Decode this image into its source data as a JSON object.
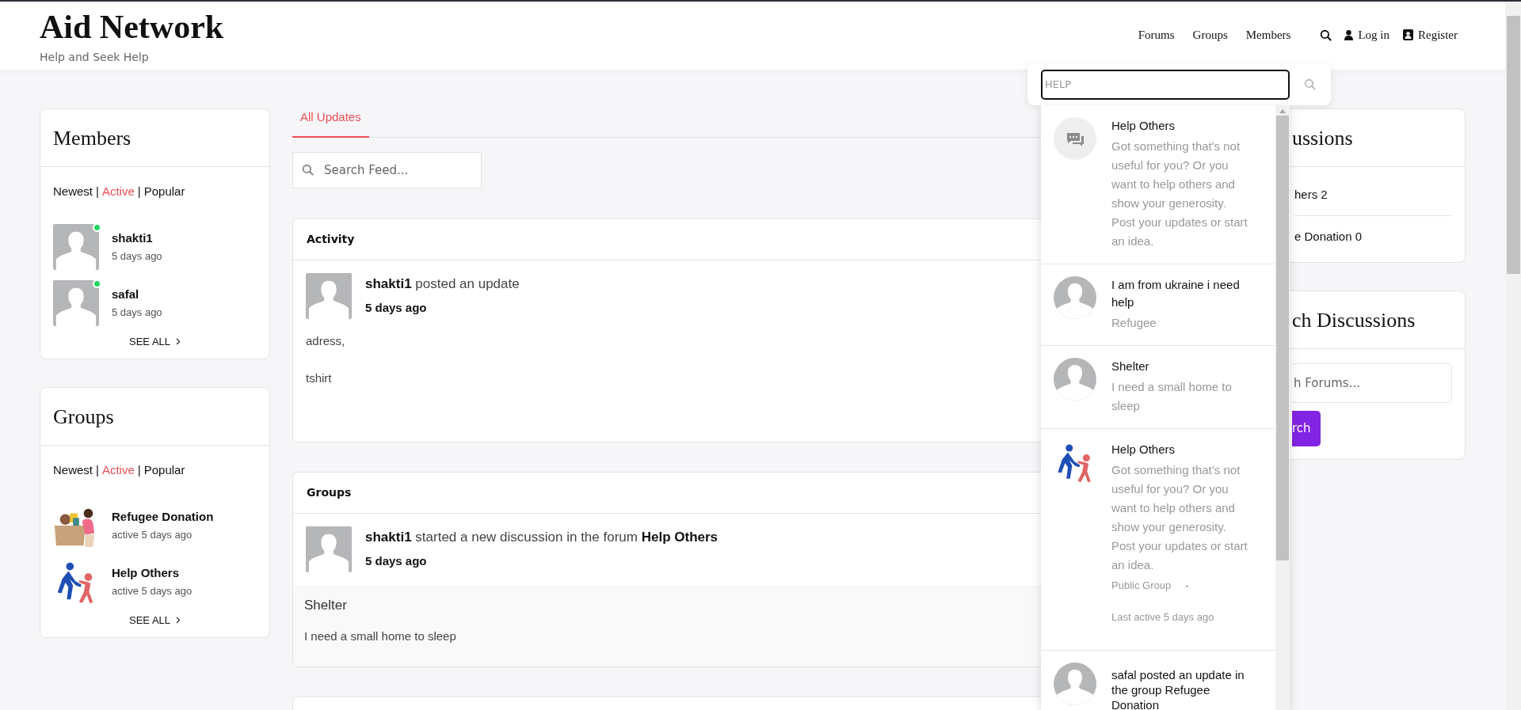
{
  "header": {
    "title": "Aid Network",
    "tagline": "Help and Seek Help",
    "nav": [
      {
        "label": "Forums"
      },
      {
        "label": "Groups"
      },
      {
        "label": "Members"
      }
    ],
    "login": "Log in",
    "register": "Register"
  },
  "members": {
    "title": "Members",
    "separator": "|",
    "filters": [
      {
        "label": "Newest",
        "selected": false
      },
      {
        "label": "Active",
        "selected": true
      },
      {
        "label": "Popular",
        "selected": false
      }
    ],
    "items": [
      {
        "name": "shakti1",
        "time": "5 days ago",
        "online": true
      },
      {
        "name": "safal",
        "time": "5 days ago",
        "online": true
      }
    ],
    "see_all": "SEE ALL"
  },
  "groups": {
    "title": "Groups",
    "separator": "|",
    "filters": [
      {
        "label": "Newest",
        "selected": false
      },
      {
        "label": "Active",
        "selected": true
      },
      {
        "label": "Popular",
        "selected": false
      }
    ],
    "items": [
      {
        "name": "Refugee Donation",
        "time": "active 5 days ago"
      },
      {
        "name": "Help Others",
        "time": "active 5 days ago"
      }
    ],
    "see_all": "SEE ALL"
  },
  "feed": {
    "tabs": [
      {
        "label": "All Updates",
        "selected": true
      }
    ],
    "search_placeholder": "Search Feed...",
    "cards": [
      {
        "heading": "Activity",
        "line": "**shakti1** posted an update",
        "time": "5 days ago",
        "body": [
          "adress,",
          "tshirt"
        ]
      },
      {
        "heading": "Groups",
        "line": "**shakti1** started a new discussion in the forum **Help Others**",
        "time": "5 days ago",
        "discussion": {
          "title": "Shelter",
          "text": "I need a small home to sleep"
        }
      }
    ]
  },
  "right": {
    "discussions": {
      "title": "ussions",
      "items": [
        "hers 2",
        "e Donation 0"
      ]
    },
    "search": {
      "title": "ch Discussions",
      "placeholder": "h Forums...",
      "button": "rch"
    }
  },
  "search_dropdown": {
    "query": "HELP",
    "results": [
      {
        "kind": "forum",
        "title": "Help Others",
        "text": "Got something that's not useful for you? Or you want to help others and show your generosity. Post your updates or start an idea."
      },
      {
        "kind": "discussion",
        "title": "I am from ukraine i need help",
        "text": "Refugee"
      },
      {
        "kind": "discussion",
        "title": "Shelter",
        "text": "I need a small home to sleep"
      },
      {
        "kind": "group",
        "title": "Help Others",
        "text": "Got something that’s not useful for you? Or you want to help others and show your generosity. Post your updates or start an idea.",
        "status": "Public Group",
        "separator": "·",
        "activity": "Last active 5 days ago"
      },
      {
        "kind": "activity",
        "title": "safal posted an update in the group Refugee Donation"
      }
    ]
  }
}
